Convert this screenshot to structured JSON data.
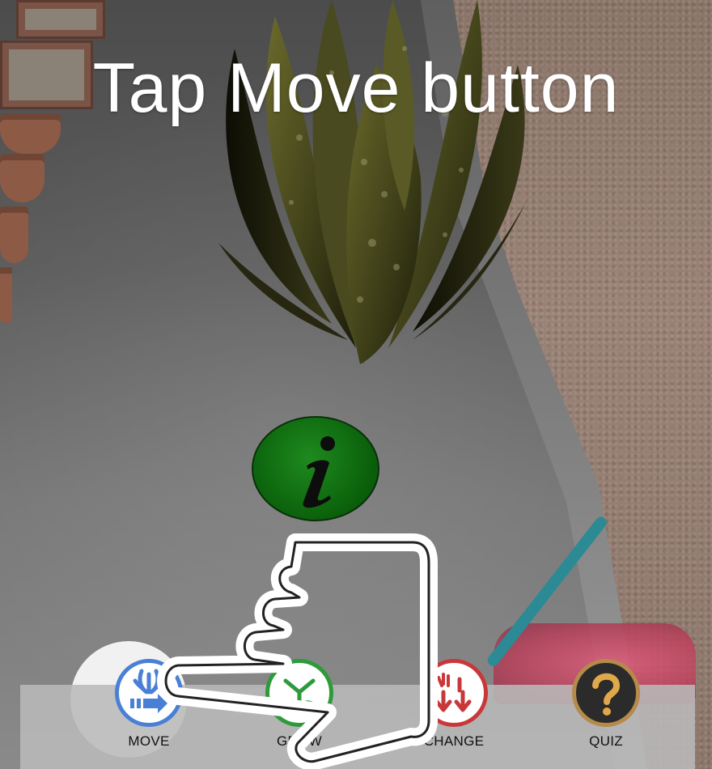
{
  "instruction": {
    "text": "Tap Move button"
  },
  "info_button": {
    "icon": "info-icon",
    "color": "#0a5f0a"
  },
  "toolbar": {
    "items": [
      {
        "label": "MOVE",
        "icon": "move-icon",
        "accent": "#4a7fd6",
        "selected": true
      },
      {
        "label": "GROW",
        "icon": "grow-icon",
        "accent": "#2e9a3a",
        "selected": false
      },
      {
        "label": "CHANGE",
        "icon": "change-icon",
        "accent": "#c8383a",
        "selected": false
      },
      {
        "label": "QUIZ",
        "icon": "quiz-icon",
        "accent": "#b58a4a",
        "selected": false
      }
    ]
  },
  "tutorial": {
    "pointer": "pointing-hand-icon"
  }
}
